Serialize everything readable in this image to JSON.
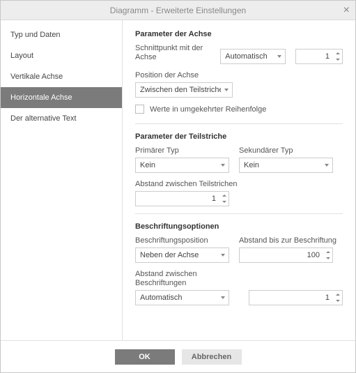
{
  "dialog": {
    "title": "Diagramm - Erweiterte Einstellungen"
  },
  "sidebar": {
    "items": [
      {
        "label": "Typ und Daten"
      },
      {
        "label": "Layout"
      },
      {
        "label": "Vertikale Achse"
      },
      {
        "label": "Horizontale Achse"
      },
      {
        "label": "Der alternative Text"
      }
    ],
    "active_index": 3
  },
  "axis_params": {
    "title": "Parameter der Achse",
    "cross_label": "Schnittpunkt mit der Achse",
    "cross_mode": "Automatisch",
    "cross_value": "1",
    "position_label": "Position der Achse",
    "position_value": "Zwischen den Teilstrichen",
    "reverse_label": "Werte in umgekehrter Reihenfolge"
  },
  "tick_params": {
    "title": "Parameter der Teilstriche",
    "primary_label": "Primärer Typ",
    "primary_value": "Kein",
    "secondary_label": "Sekundärer Typ",
    "secondary_value": "Kein",
    "interval_label": "Abstand zwischen Teilstrichen",
    "interval_value": "1"
  },
  "label_opts": {
    "title": "Beschriftungsoptionen",
    "position_label": "Beschriftungsposition",
    "position_value": "Neben der Achse",
    "distance_label": "Abstand bis zur Beschriftung",
    "distance_value": "100",
    "interval_label": "Abstand zwischen Beschriftungen",
    "interval_mode": "Automatisch",
    "interval_value": "1"
  },
  "footer": {
    "ok": "OK",
    "cancel": "Abbrechen"
  }
}
